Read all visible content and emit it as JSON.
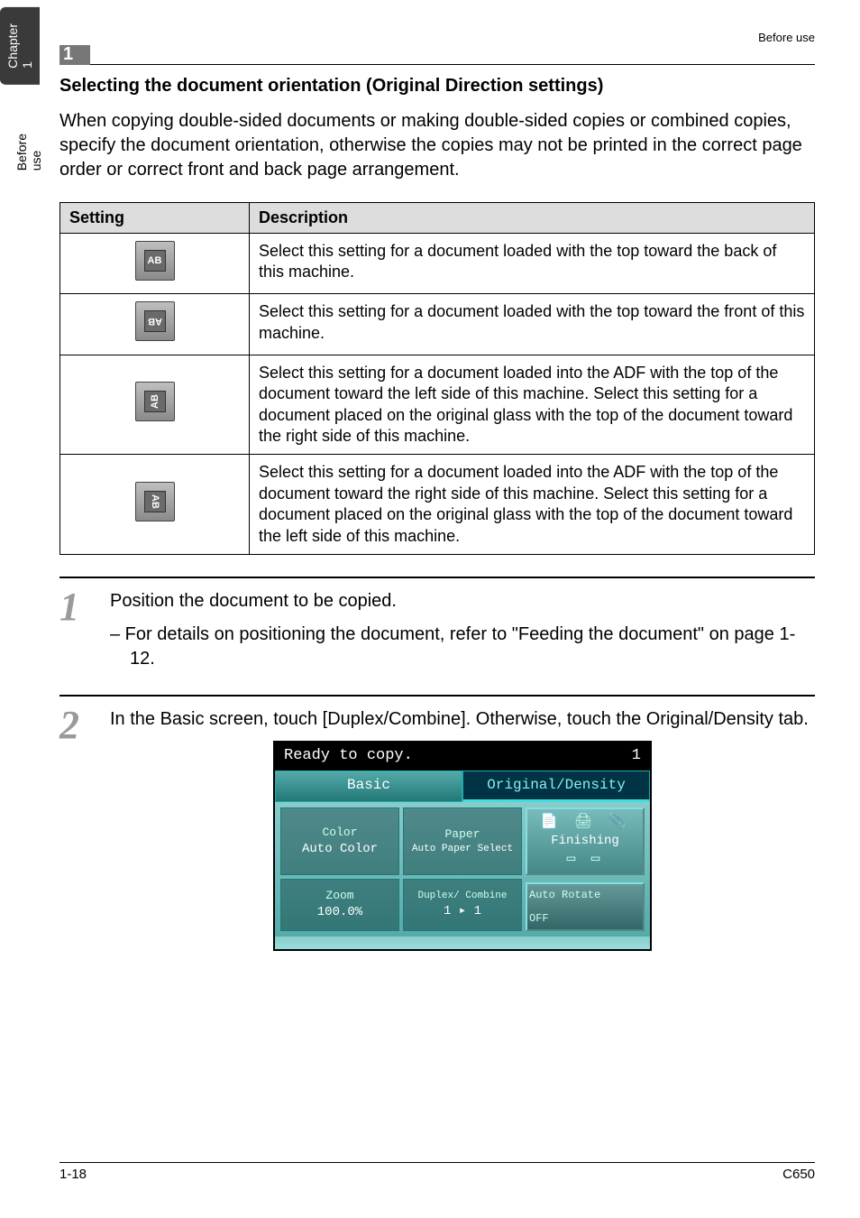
{
  "sideTabs": {
    "chapter": "Chapter 1",
    "section": "Before use"
  },
  "header": {
    "num": "1",
    "label": "Before use"
  },
  "title": "Selecting the document orientation (Original Direction settings)",
  "intro": "When copying double-sided documents or making double-sided copies or combined copies, specify the document orientation, otherwise the copies may not be printed in the correct page order or correct front and back page arrangement.",
  "table": {
    "hdrSetting": "Setting",
    "hdrDesc": "Description",
    "rows": [
      {
        "iconText": "AB",
        "iconRotate": "0",
        "desc": "Select this setting for a document loaded with the top toward the back of this machine."
      },
      {
        "iconText": "AB",
        "iconRotate": "180",
        "desc": "Select this setting for a document loaded with the top toward the front of this machine."
      },
      {
        "iconText": "AB",
        "iconRotate": "270",
        "desc": "Select this setting for a document loaded into the ADF with the top of the document toward the left side of this machine. Select this setting for a document placed on the original glass with the top of the document toward the right side of this machine."
      },
      {
        "iconText": "AB",
        "iconRotate": "90",
        "desc": "Select this setting for a document loaded into the ADF with the top of the document toward the right side of this machine. Select this setting for a document placed on the original glass with the top of the document toward the left side of this machine."
      }
    ]
  },
  "steps": [
    {
      "num": "1",
      "text": "Position the document to be copied.",
      "sub": "–  For details on positioning the document, refer to \"Feeding the document\" on page 1-12."
    },
    {
      "num": "2",
      "text": "In the Basic screen, touch [Duplex/Combine]. Otherwise, touch the Original/Density tab."
    }
  ],
  "screen": {
    "status": "Ready to copy.",
    "count": "1",
    "tabBasic": "Basic",
    "tabOD": "Original/Density",
    "color": {
      "label": "Color",
      "value": "Auto Color"
    },
    "paper": {
      "label": "Paper",
      "value": "Auto Paper Select"
    },
    "finishing": "Finishing",
    "zoom": {
      "label": "Zoom",
      "value": "100.0%"
    },
    "duplex": {
      "label": "Duplex/ Combine",
      "value": "1 ▸ 1"
    },
    "autorotate": {
      "line1": "Auto Rotate",
      "line2": "OFF"
    }
  },
  "footer": {
    "left": "1-18",
    "right": "C650"
  }
}
